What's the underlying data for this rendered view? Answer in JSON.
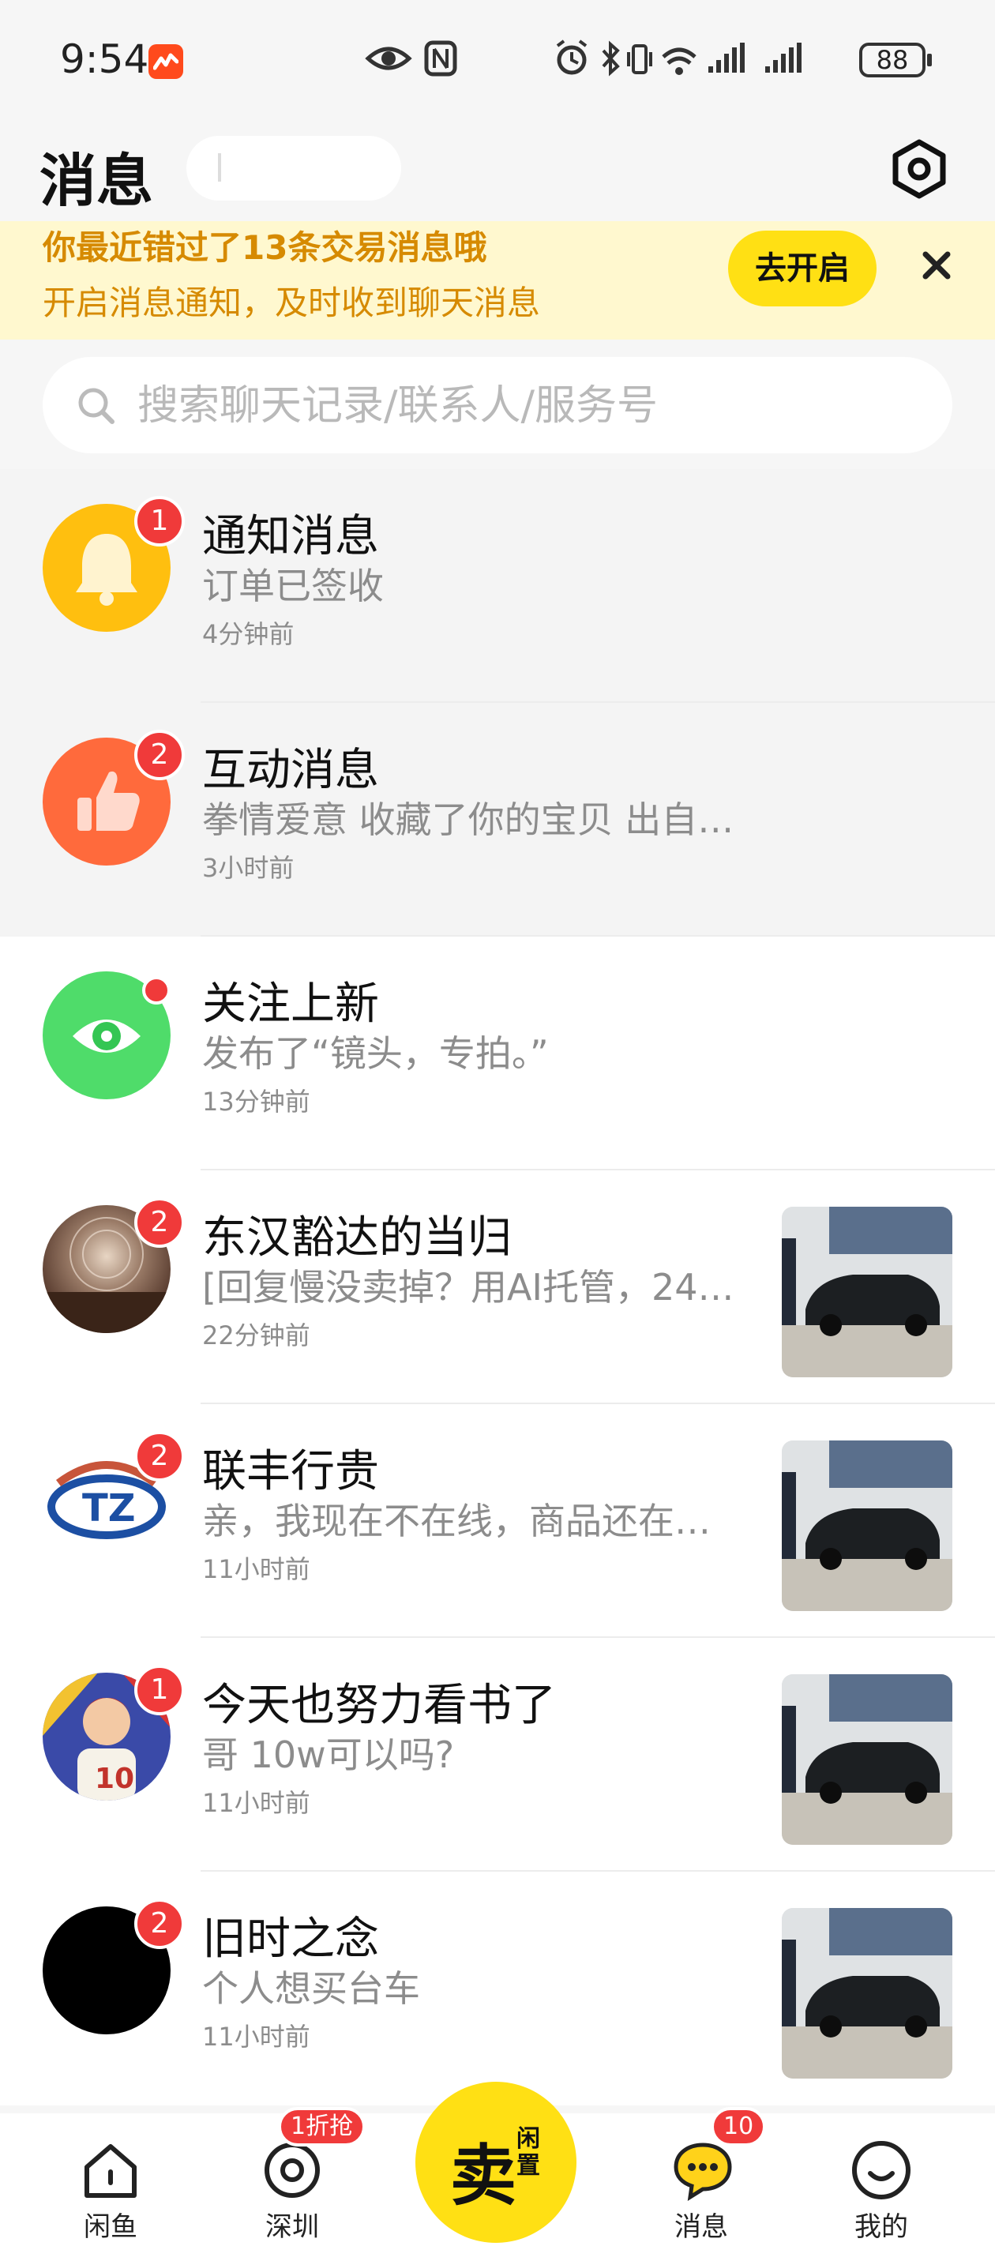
{
  "status_bar": {
    "time": "9:54",
    "battery": "88"
  },
  "header": {
    "title": "消息"
  },
  "banner": {
    "line1": "你最近错过了13条交易消息哦",
    "line2": "开启消息通知，及时收到聊天消息",
    "button": "去开启"
  },
  "search": {
    "placeholder": "搜索聊天记录/联系人/服务号"
  },
  "messages": [
    {
      "title": "通知消息",
      "preview": "订单已签收",
      "time": "4分钟前",
      "badge": "1"
    },
    {
      "title": "互动消息",
      "preview": "拳情爱意 收藏了你的宝贝 出自…",
      "time": "3小时前",
      "badge": "2"
    },
    {
      "title": "关注上新",
      "preview": "发布了“镜头，专拍。”",
      "time": "13分钟前"
    },
    {
      "title": "东汉豁达的当归",
      "preview": "[回复慢没卖掉？用AI托管，24…",
      "time": "22分钟前",
      "badge": "2"
    },
    {
      "title": "联丰行贵",
      "preview": "亲，我现在不在线，商品还在…",
      "time": "11小时前",
      "badge": "2"
    },
    {
      "title": "今天也努力看书了",
      "preview": "哥 10w可以吗?",
      "time": "11小时前",
      "badge": "1"
    },
    {
      "title": "旧时之念",
      "preview": "个人想买台车",
      "time": "11小时前",
      "badge": "2"
    }
  ],
  "nav": {
    "home": "闲鱼",
    "city": "深圳",
    "city_badge": "1折抢",
    "sell": "卖",
    "sell_sub": "闲置",
    "messages": "消息",
    "messages_badge": "10",
    "me": "我的"
  },
  "colors": {
    "accent": "#ffe014",
    "badge": "#f03a3a",
    "banner_text": "#d68a00"
  }
}
